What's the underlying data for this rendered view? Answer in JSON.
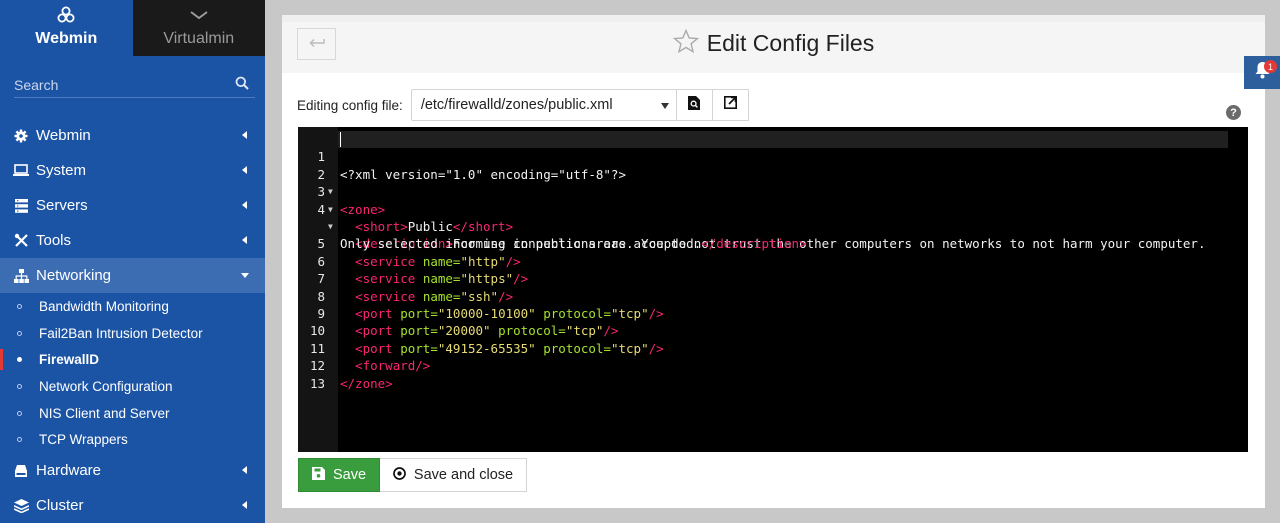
{
  "sidebar": {
    "tabs": [
      {
        "label": "Webmin",
        "icon": "webmin-logo-icon",
        "active": true
      },
      {
        "label": "Virtualmin",
        "icon": "chevron-down-icon",
        "active": false
      }
    ],
    "search_placeholder": "Search",
    "menu": [
      {
        "label": "Webmin",
        "icon": "gear-icon"
      },
      {
        "label": "System",
        "icon": "laptop-icon"
      },
      {
        "label": "Servers",
        "icon": "server-icon"
      },
      {
        "label": "Tools",
        "icon": "tools-icon"
      },
      {
        "label": "Networking",
        "icon": "network-icon",
        "open": true
      },
      {
        "label": "Hardware",
        "icon": "hdd-icon"
      },
      {
        "label": "Cluster",
        "icon": "layers-icon"
      }
    ],
    "networking_items": [
      {
        "label": "Bandwidth Monitoring"
      },
      {
        "label": "Fail2Ban Intrusion Detector"
      },
      {
        "label": "FirewallD",
        "active": true
      },
      {
        "label": "Network Configuration"
      },
      {
        "label": "NIS Client and Server"
      },
      {
        "label": "TCP Wrappers"
      }
    ]
  },
  "header": {
    "back_icon": "back-arrow-icon",
    "title": "Edit Config Files"
  },
  "config": {
    "label": "Editing config file:",
    "selected_file": "/etc/firewalld/zones/public.xml",
    "view_icon": "view-file-icon",
    "open_icon": "open-external-icon",
    "help_icon": "help-icon"
  },
  "editor": {
    "lines": [
      {
        "n": "1",
        "fold": false
      },
      {
        "n": "2",
        "fold": true
      },
      {
        "n": "3",
        "fold": true
      },
      {
        "n": "4",
        "fold": true
      },
      {
        "n": "",
        "fold": false
      },
      {
        "n": "5",
        "fold": false
      },
      {
        "n": "6",
        "fold": false
      },
      {
        "n": "7",
        "fold": false
      },
      {
        "n": "8",
        "fold": false
      },
      {
        "n": "9",
        "fold": false
      },
      {
        "n": "10",
        "fold": false
      },
      {
        "n": "11",
        "fold": false
      },
      {
        "n": "12",
        "fold": false
      },
      {
        "n": "13",
        "fold": false
      }
    ],
    "text": {
      "l1": "<?xml version=\"1.0\" encoding=\"utf-8\"?>",
      "zone_open": "<zone>",
      "short_open": "<short>",
      "short_val": "Public",
      "short_close": "</short>",
      "desc_open": "<description>",
      "desc_val_1": "For use in public areas. You do not trust the other computers on networks to not harm your computer.",
      "desc_val_2": "Only selected incoming connections are accepted.",
      "desc_close": "</description>",
      "service_tag": "<service",
      "name_attr": "name=",
      "http": "\"http\"",
      "https": "\"https\"",
      "ssh": "\"ssh\"",
      "self_close": "/>",
      "port_tag": "<port",
      "port_attr": "port=",
      "protocol_attr": "protocol=",
      "p1": "\"10000-10100\"",
      "p2": "\"20000\"",
      "p3": "\"49152-65535\"",
      "tcp": "\"tcp\"",
      "forward": "<forward/>",
      "zone_close": "</zone>"
    }
  },
  "actions": {
    "save_label": "Save",
    "save_close_label": "Save and close"
  },
  "notifications": {
    "count": "1"
  },
  "colors": {
    "sidebar": "#1c54a5",
    "save_button": "#3a9d3d",
    "xml_tag": "#f92672",
    "xml_attr": "#a6e22e",
    "xml_string": "#e6db74"
  }
}
